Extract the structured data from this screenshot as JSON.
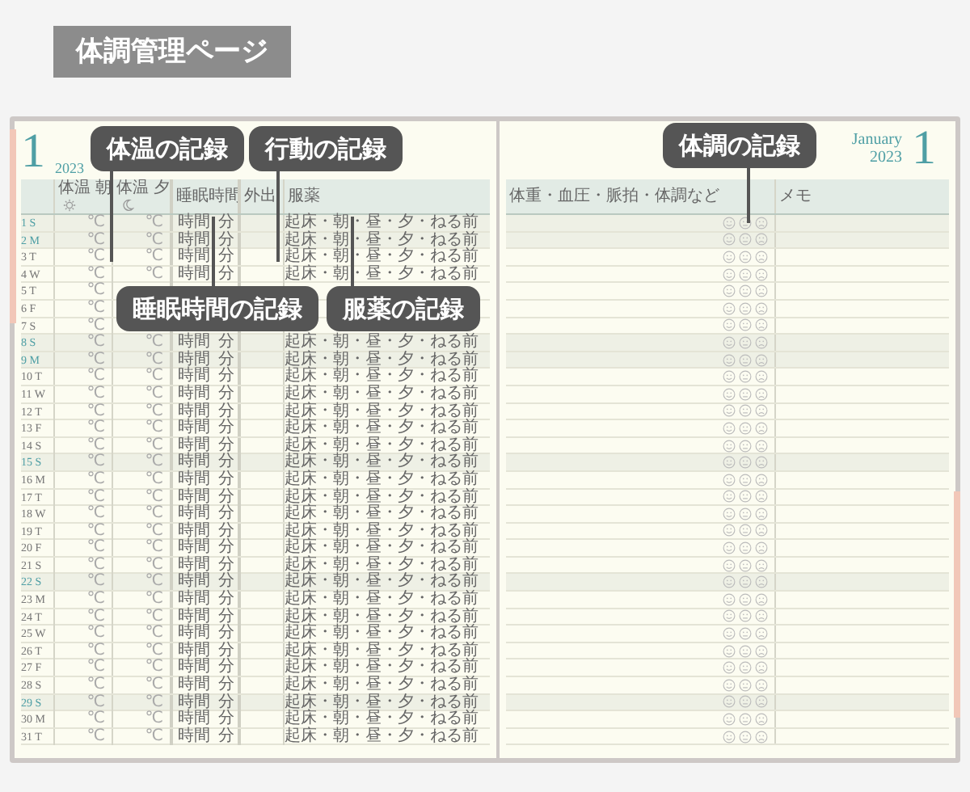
{
  "heading": "体調管理ページ",
  "left_page": {
    "month": "1",
    "year": "2023",
    "columns": {
      "temp_morning": "体温 朝",
      "temp_evening": "体温 夕",
      "sleep": "睡眠時間",
      "outing": "外出",
      "medication": "服薬"
    },
    "days": [
      {
        "day": "1",
        "weekday": "S",
        "holiday": true,
        "temp_morning": "℃",
        "temp_evening": "℃",
        "sleep_hours": "時間",
        "sleep_minutes": "分",
        "medication": "起床・朝・昼・夕・ねる前"
      },
      {
        "day": "2",
        "weekday": "M",
        "holiday": true,
        "temp_morning": "℃",
        "temp_evening": "℃",
        "sleep_hours": "時間",
        "sleep_minutes": "分",
        "medication": "起床・朝・昼・夕・ねる前"
      },
      {
        "day": "3",
        "weekday": "T",
        "holiday": false,
        "temp_morning": "℃",
        "temp_evening": "℃",
        "sleep_hours": "時間",
        "sleep_minutes": "分",
        "medication": "起床・朝・昼・夕・ねる前"
      },
      {
        "day": "4",
        "weekday": "W",
        "holiday": false,
        "temp_morning": "℃",
        "temp_evening": "℃",
        "sleep_hours": "時間",
        "sleep_minutes": "分",
        "medication": "起床・朝・昼・夕・ねる前"
      },
      {
        "day": "5",
        "weekday": "T",
        "holiday": false,
        "temp_morning": "℃"
      },
      {
        "day": "6",
        "weekday": "F",
        "holiday": false,
        "temp_morning": "℃"
      },
      {
        "day": "7",
        "weekday": "S",
        "holiday": false,
        "temp_morning": "℃"
      },
      {
        "day": "8",
        "weekday": "S",
        "holiday": true,
        "temp_morning": "℃",
        "temp_evening": "℃",
        "sleep_hours": "時間",
        "sleep_minutes": "分",
        "medication": "起床・朝・昼・夕・ねる前"
      },
      {
        "day": "9",
        "weekday": "M",
        "holiday": true,
        "temp_morning": "℃",
        "temp_evening": "℃",
        "sleep_hours": "時間",
        "sleep_minutes": "分",
        "medication": "起床・朝・昼・夕・ねる前"
      },
      {
        "day": "10",
        "weekday": "T",
        "holiday": false,
        "temp_morning": "℃",
        "temp_evening": "℃",
        "sleep_hours": "時間",
        "sleep_minutes": "分",
        "medication": "起床・朝・昼・夕・ねる前"
      },
      {
        "day": "11",
        "weekday": "W",
        "holiday": false,
        "temp_morning": "℃",
        "temp_evening": "℃",
        "sleep_hours": "時間",
        "sleep_minutes": "分",
        "medication": "起床・朝・昼・夕・ねる前"
      },
      {
        "day": "12",
        "weekday": "T",
        "holiday": false,
        "temp_morning": "℃",
        "temp_evening": "℃",
        "sleep_hours": "時間",
        "sleep_minutes": "分",
        "medication": "起床・朝・昼・夕・ねる前"
      },
      {
        "day": "13",
        "weekday": "F",
        "holiday": false,
        "temp_morning": "℃",
        "temp_evening": "℃",
        "sleep_hours": "時間",
        "sleep_minutes": "分",
        "medication": "起床・朝・昼・夕・ねる前"
      },
      {
        "day": "14",
        "weekday": "S",
        "holiday": false,
        "temp_morning": "℃",
        "temp_evening": "℃",
        "sleep_hours": "時間",
        "sleep_minutes": "分",
        "medication": "起床・朝・昼・夕・ねる前"
      },
      {
        "day": "15",
        "weekday": "S",
        "holiday": true,
        "temp_morning": "℃",
        "temp_evening": "℃",
        "sleep_hours": "時間",
        "sleep_minutes": "分",
        "medication": "起床・朝・昼・夕・ねる前"
      },
      {
        "day": "16",
        "weekday": "M",
        "holiday": false,
        "temp_morning": "℃",
        "temp_evening": "℃",
        "sleep_hours": "時間",
        "sleep_minutes": "分",
        "medication": "起床・朝・昼・夕・ねる前"
      },
      {
        "day": "17",
        "weekday": "T",
        "holiday": false,
        "temp_morning": "℃",
        "temp_evening": "℃",
        "sleep_hours": "時間",
        "sleep_minutes": "分",
        "medication": "起床・朝・昼・夕・ねる前"
      },
      {
        "day": "18",
        "weekday": "W",
        "holiday": false,
        "temp_morning": "℃",
        "temp_evening": "℃",
        "sleep_hours": "時間",
        "sleep_minutes": "分",
        "medication": "起床・朝・昼・夕・ねる前"
      },
      {
        "day": "19",
        "weekday": "T",
        "holiday": false,
        "temp_morning": "℃",
        "temp_evening": "℃",
        "sleep_hours": "時間",
        "sleep_minutes": "分",
        "medication": "起床・朝・昼・夕・ねる前"
      },
      {
        "day": "20",
        "weekday": "F",
        "holiday": false,
        "temp_morning": "℃",
        "temp_evening": "℃",
        "sleep_hours": "時間",
        "sleep_minutes": "分",
        "medication": "起床・朝・昼・夕・ねる前"
      },
      {
        "day": "21",
        "weekday": "S",
        "holiday": false,
        "temp_morning": "℃",
        "temp_evening": "℃",
        "sleep_hours": "時間",
        "sleep_minutes": "分",
        "medication": "起床・朝・昼・夕・ねる前"
      },
      {
        "day": "22",
        "weekday": "S",
        "holiday": true,
        "temp_morning": "℃",
        "temp_evening": "℃",
        "sleep_hours": "時間",
        "sleep_minutes": "分",
        "medication": "起床・朝・昼・夕・ねる前"
      },
      {
        "day": "23",
        "weekday": "M",
        "holiday": false,
        "temp_morning": "℃",
        "temp_evening": "℃",
        "sleep_hours": "時間",
        "sleep_minutes": "分",
        "medication": "起床・朝・昼・夕・ねる前"
      },
      {
        "day": "24",
        "weekday": "T",
        "holiday": false,
        "temp_morning": "℃",
        "temp_evening": "℃",
        "sleep_hours": "時間",
        "sleep_minutes": "分",
        "medication": "起床・朝・昼・夕・ねる前"
      },
      {
        "day": "25",
        "weekday": "W",
        "holiday": false,
        "temp_morning": "℃",
        "temp_evening": "℃",
        "sleep_hours": "時間",
        "sleep_minutes": "分",
        "medication": "起床・朝・昼・夕・ねる前"
      },
      {
        "day": "26",
        "weekday": "T",
        "holiday": false,
        "temp_morning": "℃",
        "temp_evening": "℃",
        "sleep_hours": "時間",
        "sleep_minutes": "分",
        "medication": "起床・朝・昼・夕・ねる前"
      },
      {
        "day": "27",
        "weekday": "F",
        "holiday": false,
        "temp_morning": "℃",
        "temp_evening": "℃",
        "sleep_hours": "時間",
        "sleep_minutes": "分",
        "medication": "起床・朝・昼・夕・ねる前"
      },
      {
        "day": "28",
        "weekday": "S",
        "holiday": false,
        "temp_morning": "℃",
        "temp_evening": "℃",
        "sleep_hours": "時間",
        "sleep_minutes": "分",
        "medication": "起床・朝・昼・夕・ねる前"
      },
      {
        "day": "29",
        "weekday": "S",
        "holiday": true,
        "temp_morning": "℃",
        "temp_evening": "℃",
        "sleep_hours": "時間",
        "sleep_minutes": "分",
        "medication": "起床・朝・昼・夕・ねる前"
      },
      {
        "day": "30",
        "weekday": "M",
        "holiday": false,
        "temp_morning": "℃",
        "temp_evening": "℃",
        "sleep_hours": "時間",
        "sleep_minutes": "分",
        "medication": "起床・朝・昼・夕・ねる前"
      },
      {
        "day": "31",
        "weekday": "T",
        "holiday": false,
        "temp_morning": "℃",
        "temp_evening": "℃",
        "sleep_hours": "時間",
        "sleep_minutes": "分",
        "medication": "起床・朝・昼・夕・ねる前"
      }
    ]
  },
  "right_page": {
    "month_name": "January",
    "year": "2023",
    "month": "1",
    "columns": {
      "condition": "体重・血圧・脈拍・体調など",
      "memo": "メモ"
    }
  },
  "callouts": [
    {
      "kind": "temperature",
      "text": "体温の記録"
    },
    {
      "kind": "activity",
      "text": "行動の記録"
    },
    {
      "kind": "sleep",
      "text": "睡眠時間の記録"
    },
    {
      "kind": "medication",
      "text": "服薬の記録"
    },
    {
      "kind": "condition",
      "text": "体調の記録"
    }
  ]
}
